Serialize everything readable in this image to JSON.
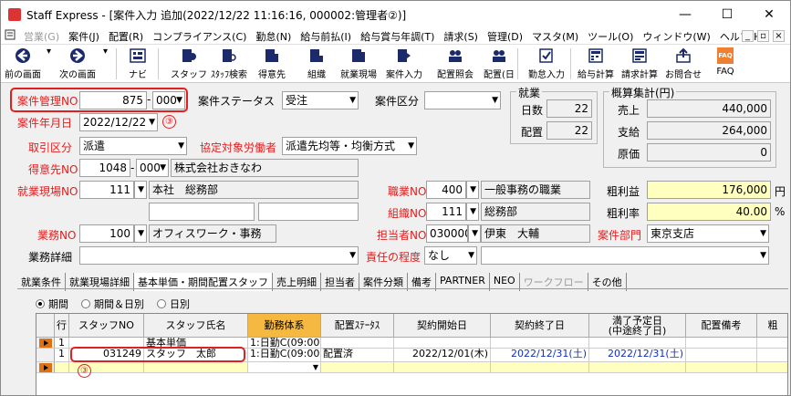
{
  "window": {
    "title": "Staff Express - [案件入力 追加(2022/12/22 11:16:16, 000002:管理者②)]",
    "minimize": "—",
    "maximize": "☐",
    "close": "✕"
  },
  "menu": [
    {
      "label": "営業(G)",
      "disabled": true
    },
    {
      "label": "案件(J)"
    },
    {
      "label": "配置(R)"
    },
    {
      "label": "コンプライアンス(C)"
    },
    {
      "label": "勤怠(N)"
    },
    {
      "label": "給与前払(I)"
    },
    {
      "label": "給与賞与年調(T)"
    },
    {
      "label": "請求(S)"
    },
    {
      "label": "管理(D)"
    },
    {
      "label": "マスタ(M)"
    },
    {
      "label": "ツール(O)"
    },
    {
      "label": "ウィンドウ(W)"
    },
    {
      "label": "ヘルプ(H)"
    }
  ],
  "toolbar": {
    "prev": "前の画面",
    "next": "次の画面",
    "navi": "ナビ",
    "staff": "スタッフ",
    "staff_search": "ｽﾀｯﾌ検索",
    "client": "得意先",
    "org": "組織",
    "site": "就業現場",
    "job_entry": "案件入力",
    "placement_ref": "配置照会",
    "placement_day": "配置(日",
    "attendance": "勤怠入力",
    "payroll": "給与計算",
    "billing": "請求計算",
    "inquiry": "お問合せ",
    "faq": "FAQ",
    "faq_icon_text": "FAQ"
  },
  "form": {
    "job_no_label": "案件管理NO",
    "job_no": "875",
    "job_no_sub": "000",
    "job_status_label": "案件ステータス",
    "job_status": "受注",
    "job_type_label": "案件区分",
    "job_type": "",
    "job_date_label": "案件年月日",
    "job_date": "2022/12/22",
    "marker": "③",
    "deal_type_label": "取引区分",
    "deal_type": "派遣",
    "agreement_label": "協定対象労働者",
    "agreement": "派遣先均等・均衡方式",
    "client_no_label": "得意先NO",
    "client_no": "1048",
    "client_sub": "000",
    "client_name": "株式会社おきなわ",
    "site_no_label": "就業現場NO",
    "site_no": "111",
    "site_name": "本社　総務部",
    "job_kind_label": "職業NO",
    "job_kind_no": "400",
    "job_kind_name": "一般事務の職業",
    "org_label": "組織NO",
    "org_no": "111",
    "org_name": "総務部",
    "work_label": "業務NO",
    "work_no": "100",
    "work_name": "オフィスワーク・事務",
    "owner_label": "担当者NO",
    "owner_no": "030000",
    "owner_name": "伊東　大輔",
    "dept_label": "案件部門",
    "dept": "東京支店",
    "work_detail_label": "業務詳細",
    "work_detail": "",
    "resp_label": "責任の程度",
    "resp": "なし",
    "resp_extra": ""
  },
  "attendance_group": {
    "title": "就業",
    "days_label": "日数",
    "days": "22",
    "placement_label": "配置",
    "placement": "22"
  },
  "summary_group": {
    "title": "概算集計(円)",
    "sales_label": "売上",
    "sales": "440,000",
    "pay_label": "支給",
    "pay": "264,000",
    "cost_label": "原価",
    "cost": "0",
    "gross_label": "粗利益",
    "gross": "176,000",
    "gross_unit": "円",
    "rate_label": "粗利率",
    "rate": "40.00",
    "rate_unit": "%"
  },
  "tabs": [
    {
      "label": "就業条件"
    },
    {
      "label": "就業現場詳細"
    },
    {
      "label": "基本単価・期間配置スタッフ"
    },
    {
      "label": "売上明細"
    },
    {
      "label": "担当者"
    },
    {
      "label": "案件分類"
    },
    {
      "label": "備考"
    },
    {
      "label": "PARTNER"
    },
    {
      "label": "NEO"
    },
    {
      "label": "ワークフロー",
      "disabled": true
    },
    {
      "label": "その他"
    }
  ],
  "period_options": {
    "period": "期間",
    "period_day": "期間＆日別",
    "day": "日別"
  },
  "grid": {
    "headers": {
      "row": "行",
      "staff_no": "スタッフNO",
      "staff_name": "スタッフ氏名",
      "shift": "勤務体系",
      "status": "配置ｽﾃｰﾀｽ",
      "start": "契約開始日",
      "end": "契約終了日",
      "planned_end_1": "満了予定日",
      "planned_end_2": "(中途終了日)",
      "remarks": "配置備考",
      "gross": "粗"
    },
    "row1": {
      "row": "1",
      "staff_name": "基本単価",
      "shift": "1:日勤C(09:00"
    },
    "row2": {
      "row": "1",
      "staff_no": "031249",
      "staff_name": "スタッフ　太郎",
      "shift": "1:日勤C(09:00",
      "status": "配置済",
      "start": "2022/12/01(木)",
      "end": "2022/12/31(土)",
      "planned_end": "2022/12/31(土)"
    },
    "marker": "③"
  },
  "colors": {
    "accent_red": "#e02020",
    "header_orange": "#f5b840",
    "yellow_field": "#ffffc0",
    "date_blue": "#1030c0"
  }
}
